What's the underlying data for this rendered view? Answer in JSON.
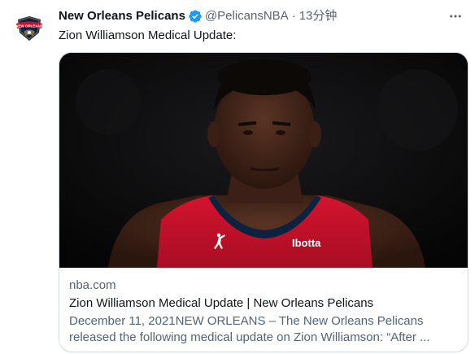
{
  "tweet": {
    "display_name": "New Orleans Pelicans",
    "handle": "@PelicansNBA",
    "separator": "·",
    "time": "13分钟",
    "text": "Zion Williamson Medical Update:",
    "avatar_icon": "pelicans-logo-icon",
    "verified_icon": "verified-badge-icon",
    "more_icon": "more-options-icon"
  },
  "card": {
    "domain": "nba.com",
    "title": "Zion Williamson Medical Update | New Orleans Pelicans",
    "description": "December 11, 2021NEW ORLEANS – The New Orleans Pelicans released the following medical update on Zion Williamson: “After ...",
    "jersey_brand": "Ibotta"
  },
  "colors": {
    "verified": "#1d9bf0",
    "secondary_text": "#536471",
    "primary_text": "#0f1419",
    "card_border": "#cfd9de",
    "jersey_red": "#c8102e",
    "pelicans_navy": "#0c2340",
    "pelicans_gold": "#85714d"
  }
}
